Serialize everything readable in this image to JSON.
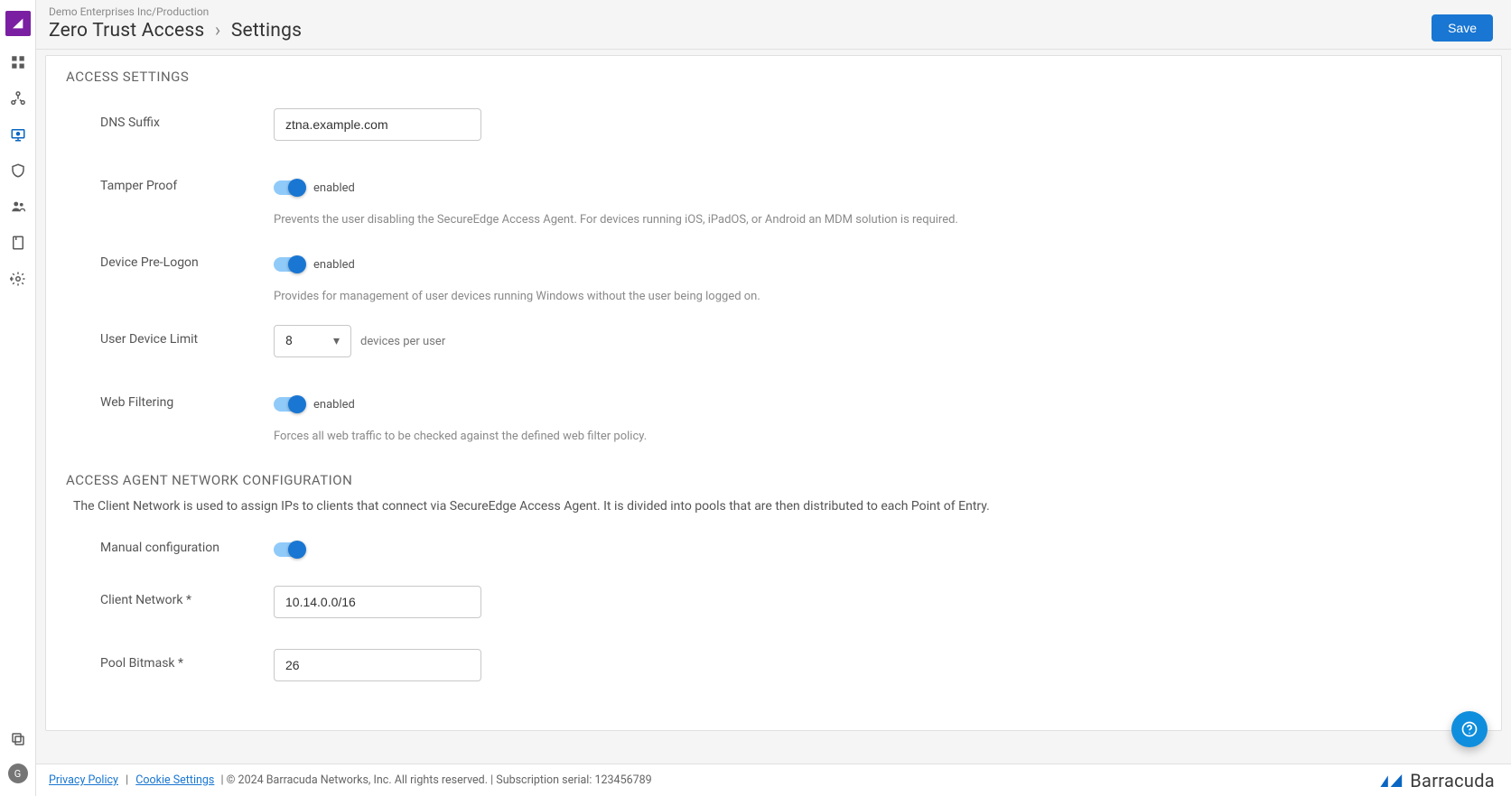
{
  "header": {
    "org_path": "Demo Enterprises Inc/Production",
    "breadcrumb_root": "Zero Trust Access",
    "breadcrumb_sep": "›",
    "breadcrumb_current": "Settings",
    "save_label": "Save"
  },
  "sections": {
    "access_settings_title": "ACCESS SETTINGS",
    "network_config_title": "ACCESS AGENT NETWORK CONFIGURATION",
    "network_config_desc": "The Client Network is used to assign IPs to clients that connect via SecureEdge Access Agent. It is divided into pools that are then distributed to each Point of Entry."
  },
  "fields": {
    "dns_suffix": {
      "label": "DNS Suffix",
      "value": "ztna.example.com"
    },
    "tamper_proof": {
      "label": "Tamper Proof",
      "state": "enabled",
      "help": "Prevents the user disabling the SecureEdge Access Agent. For devices running iOS, iPadOS, or Android an MDM solution is required."
    },
    "pre_logon": {
      "label": "Device Pre-Logon",
      "state": "enabled",
      "help": "Provides for management of user devices running Windows without the user being logged on."
    },
    "device_limit": {
      "label": "User Device Limit",
      "value": "8",
      "suffix": "devices per user"
    },
    "web_filtering": {
      "label": "Web Filtering",
      "state": "enabled",
      "help": "Forces all web traffic to be checked against the defined web filter policy."
    },
    "manual_config": {
      "label": "Manual configuration"
    },
    "client_network": {
      "label": "Client Network *",
      "value": "10.14.0.0/16"
    },
    "pool_bitmask": {
      "label": "Pool Bitmask *",
      "value": "26"
    }
  },
  "footer": {
    "privacy": "Privacy Policy",
    "cookie": "Cookie Settings",
    "copyright": "| © 2024 Barracuda Networks, Inc. All rights reserved. | Subscription serial: 123456789",
    "brand": "Barracuda"
  },
  "avatar_initial": "G"
}
